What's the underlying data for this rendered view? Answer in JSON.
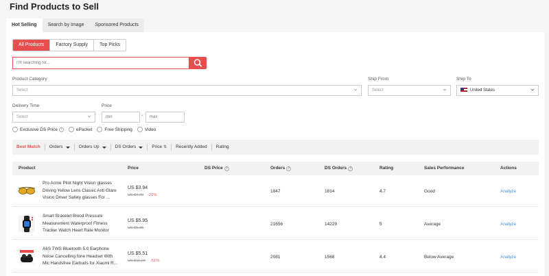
{
  "page": {
    "title": "Find Products to Sell"
  },
  "top_tabs": [
    "Hot Selling",
    "Search by Image",
    "Sponsored Products"
  ],
  "segments": [
    "All Products",
    "Factory Supply",
    "Top Picks"
  ],
  "search": {
    "placeholder": "I'm searching for..."
  },
  "filters": {
    "category": {
      "label": "Product Category",
      "value": "Select"
    },
    "ship_from": {
      "label": "Ship From",
      "value": "Select"
    },
    "ship_to": {
      "label": "Ship To",
      "value": "United States"
    },
    "delivery": {
      "label": "Delivery Time",
      "value": "Select"
    },
    "price": {
      "label": "Price",
      "min": "min",
      "max": "max",
      "separator": "-"
    }
  },
  "checkboxes": [
    "Exclusive DS Price",
    "ePacket",
    "Free Shipping",
    "Video"
  ],
  "sort": {
    "best_match": "Best Match",
    "orders": "Orders",
    "orders_up": "Orders Up",
    "ds_orders": "DS Orders",
    "price": "Price",
    "price_arrows": "⇅",
    "recently_added": "Recently Added",
    "rating": "Rating"
  },
  "table": {
    "headers": {
      "product": "Product",
      "price": "Price",
      "ds_price": "DS Price",
      "orders": "Orders",
      "ds_orders": "DS Orders",
      "rating": "Rating",
      "sales_performance": "Sales Performance",
      "actions": "Actions"
    },
    "rows": [
      {
        "name": "Pro Acme Pilot Night Vision glasses Driving Yellow Lens Classic Anti Glare Vision Driver Safety glasses For ...",
        "price": "US $3.94",
        "old_price": "US $4.99",
        "discount": "-21%",
        "orders": "1847",
        "ds_orders": "1814",
        "rating": "4.7",
        "performance": "Good",
        "action": "Analyze",
        "thumb_icon": "sunglasses-icon"
      },
      {
        "name": "Smart Bracelet Blood Pressure Measurement Waterproof Fitness Tracker Watch Heart Rate Monitor Pedom...",
        "price": "US $5.95",
        "old_price": "US $5.95",
        "discount": "",
        "orders": "21656",
        "ds_orders": "14229",
        "rating": "5",
        "performance": "Average",
        "action": "Analyze",
        "thumb_icon": "smartwatch-icon"
      },
      {
        "name": "A6S TWS Bluetooth 5.0 Earphone Noise Cancelling fone Headset With Mic Handsfree Earbuds for Xiaomi R...",
        "price": "US $5.51",
        "old_price": "US $11.26",
        "discount": "-51%",
        "orders": "2081",
        "ds_orders": "1568",
        "rating": "4.4",
        "performance": "Below Average",
        "action": "Analyze",
        "thumb_icon": "earbuds-icon"
      }
    ]
  },
  "colors": {
    "accent": "#e94e4e",
    "link": "#3b8fd6"
  }
}
